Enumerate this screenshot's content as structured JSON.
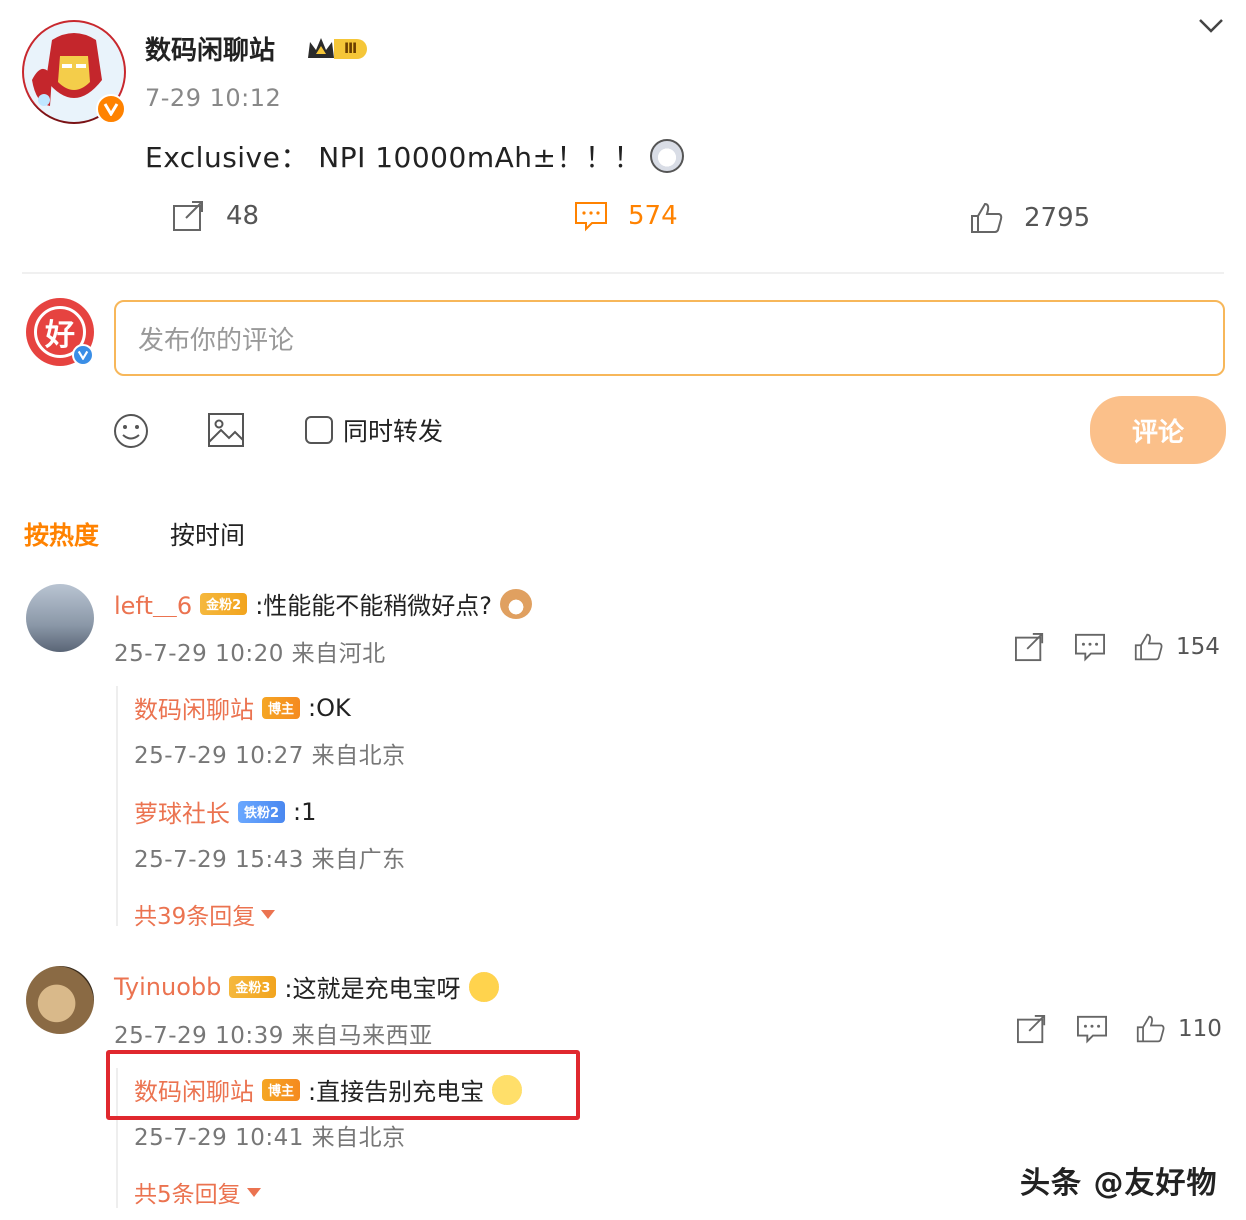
{
  "post": {
    "author": "数码闲聊站",
    "level_badge": "Ⅲ",
    "time": "7-29 10:12",
    "text": "Exclusive： NPI 10000mAh±！！！",
    "repost_count": "48",
    "comment_count": "574",
    "like_count": "2795"
  },
  "composer": {
    "avatar_char": "好",
    "placeholder": "发布你的评论",
    "repost_label": "同时转发",
    "submit_label": "评论"
  },
  "sort": {
    "hot": "按热度",
    "time": "按时间"
  },
  "comments": [
    {
      "user": "left＿6",
      "badge": "金粉2",
      "text": ":性能能不能稍微好点?",
      "meta": "25-7-29 10:20 来自河北",
      "likes": "154",
      "replies": [
        {
          "user": "数码闲聊站",
          "badge": "博主",
          "text": ":OK",
          "meta": "25-7-29 10:27 来自北京"
        },
        {
          "user": "萝球社长",
          "badge": "铁粉2",
          "text": ":1",
          "meta": "25-7-29 15:43 来自广东"
        }
      ],
      "more": "共39条回复"
    },
    {
      "user": "Tyinuobb",
      "badge": "金粉3",
      "text": ":这就是充电宝呀",
      "meta": "25-7-29 10:39 来自马来西亚",
      "likes": "110",
      "replies": [
        {
          "user": "数码闲聊站",
          "badge": "博主",
          "text": ":直接告别充电宝",
          "meta": "25-7-29 10:41 来自北京"
        }
      ],
      "more": "共5条回复"
    }
  ],
  "watermark": "头条 @友好物",
  "colors": {
    "accent": "#ff8200",
    "username": "#eb7350",
    "highlight": "#e0282e"
  }
}
